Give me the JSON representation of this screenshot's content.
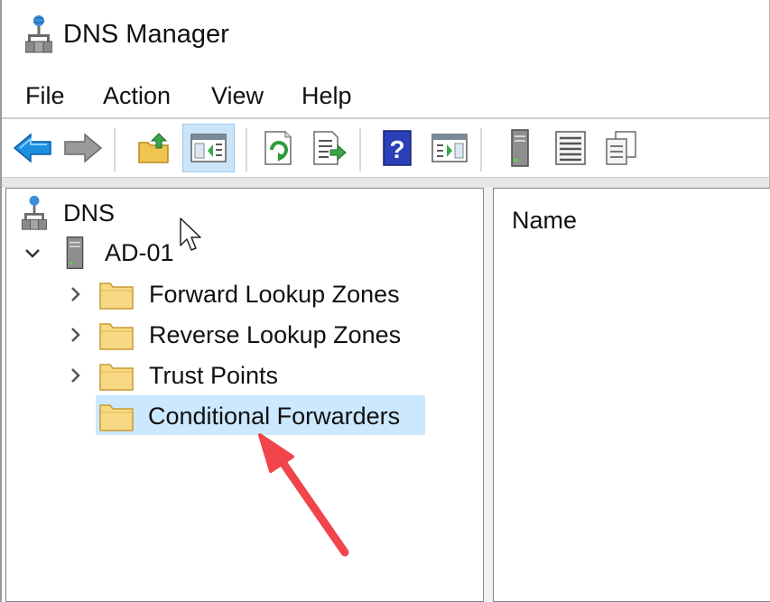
{
  "window": {
    "title": "DNS Manager"
  },
  "menubar": {
    "items": [
      "File",
      "Action",
      "View",
      "Help"
    ]
  },
  "toolbar": {
    "buttons": [
      {
        "icon": "back-arrow-icon"
      },
      {
        "icon": "forward-arrow-icon"
      },
      {
        "icon": "up-folder-icon"
      },
      {
        "icon": "show-hide-console-tree-icon",
        "active": true
      },
      {
        "icon": "refresh-icon"
      },
      {
        "icon": "export-list-icon"
      },
      {
        "icon": "help-icon"
      },
      {
        "icon": "show-hide-action-pane-icon"
      },
      {
        "icon": "server-icon"
      },
      {
        "icon": "list-icon"
      },
      {
        "icon": "copy-icon"
      }
    ]
  },
  "tree": {
    "root_label": "DNS",
    "server_label": "AD-01",
    "children": [
      {
        "label": "Forward Lookup Zones",
        "expandable": true
      },
      {
        "label": "Reverse Lookup Zones",
        "expandable": true
      },
      {
        "label": "Trust Points",
        "expandable": true
      },
      {
        "label": "Conditional Forwarders",
        "expandable": false,
        "selected": true
      }
    ]
  },
  "details": {
    "column_name": "Name"
  },
  "colors": {
    "selection": "#cce8ff",
    "annotation_arrow": "#f0454b",
    "folder": "#f5d27a",
    "accent_blue": "#1e7fd6"
  }
}
